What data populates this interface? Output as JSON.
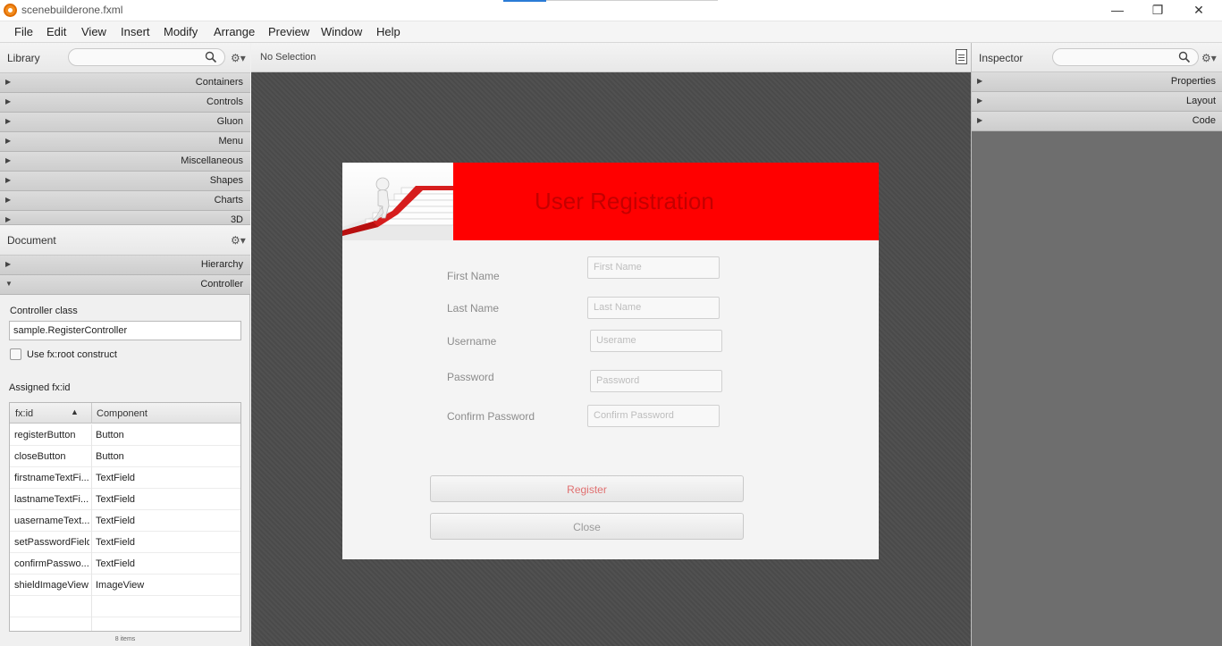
{
  "window": {
    "title": "scenebuilderone.fxml",
    "minimize": "—",
    "restore": "❐",
    "close": "✕"
  },
  "menu": [
    "File",
    "Edit",
    "View",
    "Insert",
    "Modify",
    "Arrange",
    "Preview",
    "Window",
    "Help"
  ],
  "library": {
    "title": "Library",
    "sections": [
      "Containers",
      "Controls",
      "Gluon",
      "Menu",
      "Miscellaneous",
      "Shapes",
      "Charts",
      "3D"
    ]
  },
  "document": {
    "title": "Document",
    "sections": [
      "Hierarchy",
      "Controller"
    ],
    "controller_class_label": "Controller class",
    "controller_class_value": "sample.RegisterController",
    "fxroot_label": "Use fx:root construct",
    "assigned_label": "Assigned fx:id",
    "table": {
      "headers": [
        "fx:id",
        "Component"
      ],
      "rows": [
        [
          "registerButton",
          "Button"
        ],
        [
          "closeButton",
          "Button"
        ],
        [
          "firstnameTextFi...",
          "TextField"
        ],
        [
          "lastnameTextFi...",
          "TextField"
        ],
        [
          "uasernameText...",
          "TextField"
        ],
        [
          "setPasswordField",
          "TextField"
        ],
        [
          "confirmPasswo...",
          "TextField"
        ],
        [
          "shieldImageView",
          "ImageView"
        ]
      ],
      "count": "8 items"
    }
  },
  "center": {
    "selection": "No Selection"
  },
  "form": {
    "title": "User Registration",
    "fields": [
      {
        "label": "First Name",
        "placeholder": "First Name"
      },
      {
        "label": "Last Name",
        "placeholder": "Last Name"
      },
      {
        "label": "Username",
        "placeholder": "Userame"
      },
      {
        "label": "Password",
        "placeholder": "Password"
      },
      {
        "label": "Confirm Password",
        "placeholder": "Confirm Password"
      }
    ],
    "register": "Register",
    "close": "Close"
  },
  "inspector": {
    "title": "Inspector",
    "sections": [
      "Properties",
      "Layout",
      "Code"
    ]
  },
  "colors": {
    "banner": "#ff0000",
    "banner_title": "#c40000",
    "register_text": "#e07070"
  }
}
